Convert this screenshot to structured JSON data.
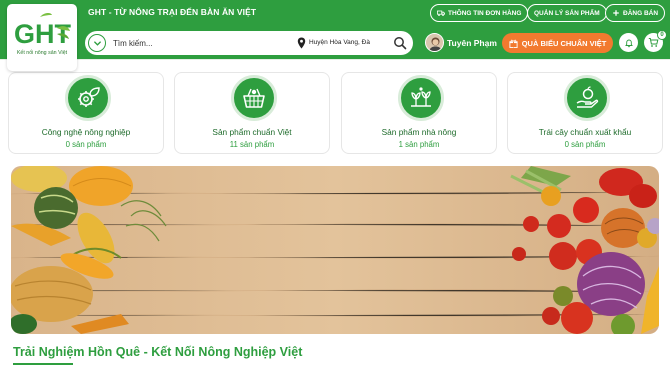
{
  "brand": {
    "logo_text": "GHT",
    "logo_subtitle": "Kết nối nông sản Việt",
    "tagline": "GHT - TỪ NÔNG TRẠI ĐẾN BÀN ĂN VIỆT"
  },
  "top_links": {
    "order_info": "THÔNG TIN ĐƠN HÀNG",
    "manage_products": "QUẢN LÝ SẢN PHẨM",
    "sell": "ĐĂNG BÁN"
  },
  "search": {
    "placeholder": "Tìm kiếm...",
    "location": "Huyện Hòa Vang, Đà ..."
  },
  "user": {
    "name": "Tuyên Phạm"
  },
  "gift_button": "QUÀ BIẾU CHUẨN VIỆT",
  "cart": {
    "count": "0"
  },
  "categories": [
    {
      "title": "Công nghệ nông nghiệp",
      "count": "0 sản phẩm",
      "icon": "gear-leaf-icon"
    },
    {
      "title": "Sản phẩm chuẩn Việt",
      "count": "11 sản phẩm",
      "icon": "basket-icon"
    },
    {
      "title": "Sản phẩm nhà nông",
      "count": "1 sản phẩm",
      "icon": "farm-icon"
    },
    {
      "title": "Trái cây chuẩn xuất khẩu",
      "count": "0 sản phẩm",
      "icon": "fruit-hand-icon"
    }
  ],
  "section_title": "Trải Nghiệm Hồn Quê - Kết Nối Nông Nghiệp Việt",
  "colors": {
    "primary": "#2e9e3f",
    "accent_orange": "#f27a2f",
    "dark_green_text": "#1e6b2b"
  }
}
